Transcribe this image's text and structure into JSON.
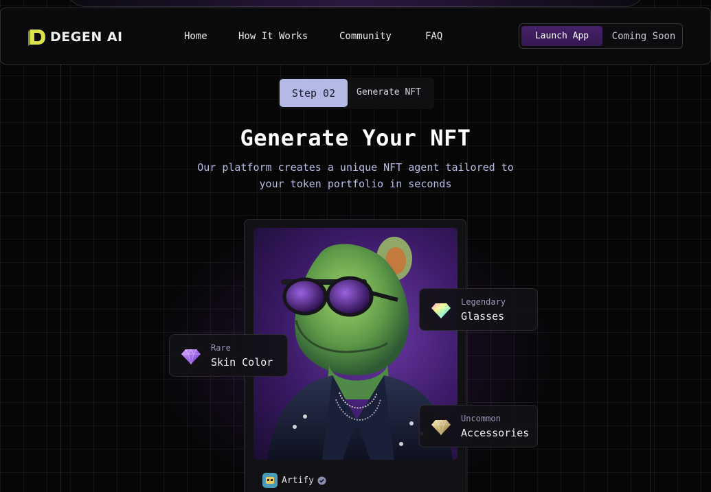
{
  "brand": {
    "name": "DEGEN AI"
  },
  "nav": {
    "links": [
      "Home",
      "How It Works",
      "Community",
      "FAQ"
    ],
    "launch_label": "Launch App",
    "soon_label": "Coming Soon"
  },
  "step": {
    "badge": "Step 02",
    "label": "Generate NFT"
  },
  "hero": {
    "title": "Generate Your NFT",
    "subtitle": "Our platform creates a unique NFT agent tailored to your token portfolio in seconds"
  },
  "card": {
    "creator": "Artify"
  },
  "traits": [
    {
      "rarity": "Legendary",
      "name": "Glasses",
      "gem": "diamond-rainbow-icon"
    },
    {
      "rarity": "Rare",
      "name": "Skin Color",
      "gem": "diamond-purple-icon"
    },
    {
      "rarity": "Uncommon",
      "name": "Accessories",
      "gem": "diamond-gold-icon"
    }
  ],
  "colors": {
    "accent_purple": "#452168",
    "step_badge": "#b4b9e6",
    "subtitle": "#b7bce4",
    "logo_yellow": "#d9e24a"
  }
}
